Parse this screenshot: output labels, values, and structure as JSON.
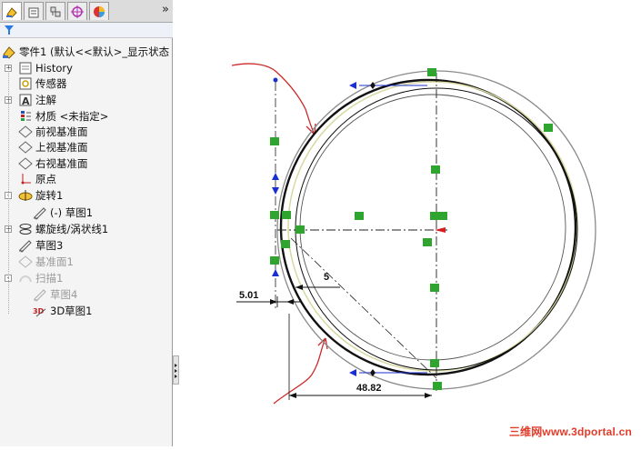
{
  "panel": {
    "tabs": [
      {
        "name": "featuremanager-tab-icon"
      },
      {
        "name": "propertymanager-tab-icon"
      },
      {
        "name": "configurationmanager-tab-icon"
      },
      {
        "name": "dimxpert-tab-icon"
      },
      {
        "name": "display-manager-tab-icon"
      }
    ],
    "more": "»",
    "tree": {
      "root": "零件1  (默认<<默认>_显示状态",
      "items": [
        {
          "label": "History",
          "icon": "history-icon",
          "expand": "+"
        },
        {
          "label": "传感器",
          "icon": "sensor-icon",
          "expand": ""
        },
        {
          "label": "注解",
          "icon": "annotation-icon",
          "expand": "+"
        },
        {
          "label": "材质 <未指定>",
          "icon": "material-icon",
          "expand": ""
        },
        {
          "label": "前视基准面",
          "icon": "plane-icon",
          "expand": ""
        },
        {
          "label": "上视基准面",
          "icon": "plane-icon",
          "expand": ""
        },
        {
          "label": "右视基准面",
          "icon": "plane-icon",
          "expand": ""
        },
        {
          "label": "原点",
          "icon": "origin-icon",
          "expand": ""
        },
        {
          "label": "旋转1",
          "icon": "revolve-icon",
          "expand": "-"
        },
        {
          "label": "(-) 草图1",
          "icon": "sketch-icon",
          "expand": ""
        },
        {
          "label": "螺旋线/涡状线1",
          "icon": "helix-icon",
          "expand": "+"
        },
        {
          "label": "草图3",
          "icon": "sketch-icon",
          "expand": ""
        },
        {
          "label": "基准面1",
          "icon": "plane-icon",
          "expand": ""
        },
        {
          "label": "扫描1",
          "icon": "sweep-icon",
          "expand": "-"
        },
        {
          "label": "草图4",
          "icon": "sketch-icon",
          "expand": ""
        },
        {
          "label": "3D草图1",
          "icon": "3d-sketch-icon",
          "expand": ""
        }
      ]
    }
  },
  "canvas": {
    "dimensions": {
      "d1": "5.01",
      "d2": "5",
      "d3": "48.82"
    },
    "colors": {
      "outer_circle": "#8a8a8a",
      "black_circle": "#111111",
      "yellow_circle": "#d8d8a0",
      "relation_marker": "#2fa52f",
      "annotation": "#cc2a2a",
      "arrow": "#1a2fd0"
    }
  },
  "watermark": "三维网www.3dportal.cn"
}
